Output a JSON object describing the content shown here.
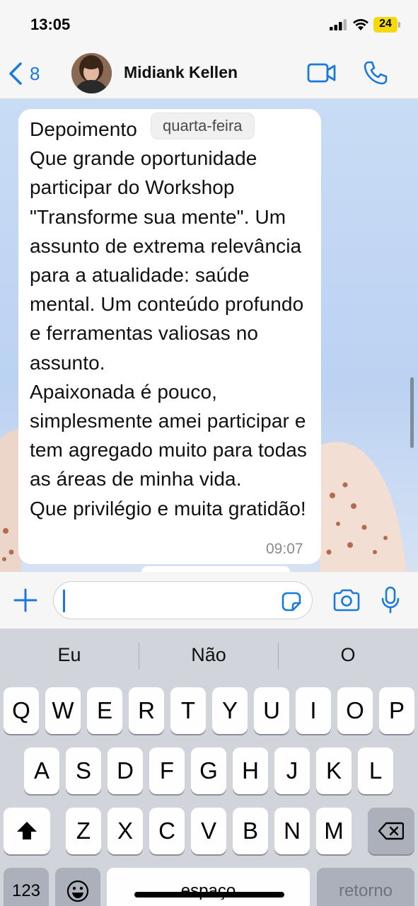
{
  "status_bar": {
    "time": "13:05",
    "battery": "24",
    "signal_icon": "cellular-signal-icon",
    "wifi_icon": "wifi-icon"
  },
  "header": {
    "back_icon": "chevron-left-icon",
    "back_count": "8",
    "contact_name": "Midiank Kellen",
    "video_icon": "video-call-icon",
    "phone_icon": "phone-icon",
    "accent_color": "#1a7adb"
  },
  "chat": {
    "date_badge": "quarta-feira",
    "message": {
      "text": "Depoimento\nQue grande oportunidade participar do Workshop \"Transforme sua mente\". Um assunto de extrema relevância para a atualidade: saúde mental. Um conteúdo profundo e ferramentas valiosas no assunto.\nApaixonada é pouco, simplesmente amei participar e tem agregado muito para todas as áreas de minha vida.\nQue privilégio e muita gratidão!",
      "time": "09:07"
    }
  },
  "input_bar": {
    "plus_icon": "plus-icon",
    "value": "",
    "sticker_icon": "sticker-icon",
    "camera_icon": "camera-icon",
    "mic_icon": "microphone-icon"
  },
  "keyboard": {
    "suggestions": [
      "Eu",
      "Não",
      "O"
    ],
    "row1": [
      "Q",
      "W",
      "E",
      "R",
      "T",
      "Y",
      "U",
      "I",
      "O",
      "P"
    ],
    "row2": [
      "A",
      "S",
      "D",
      "F",
      "G",
      "H",
      "J",
      "K",
      "L"
    ],
    "row3": [
      "Z",
      "X",
      "C",
      "V",
      "B",
      "N",
      "M"
    ],
    "shift_icon": "shift-icon",
    "backspace_icon": "backspace-icon",
    "numbers_label": "123",
    "emoji_icon": "emoji-icon",
    "space_label": "espaço",
    "return_label": "retorno"
  }
}
